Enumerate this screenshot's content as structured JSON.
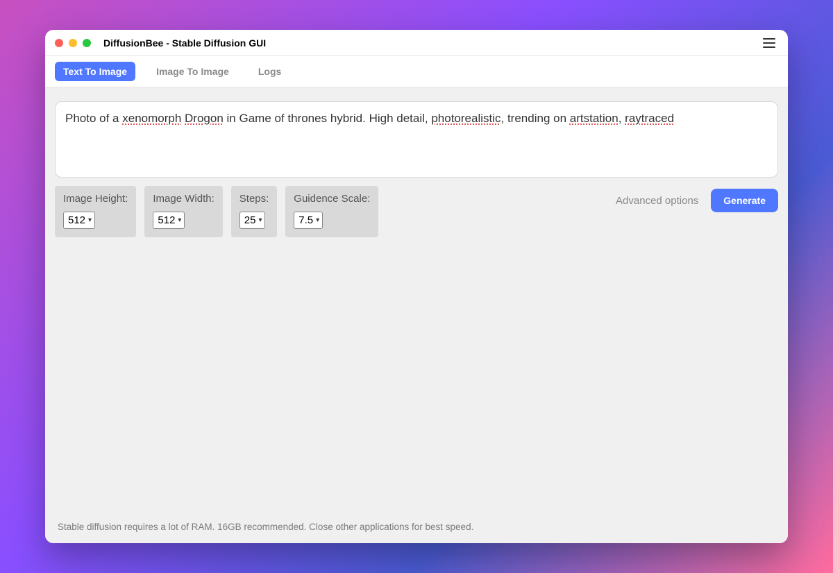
{
  "window": {
    "title": "DiffusionBee - Stable Diffusion GUI"
  },
  "tabs": {
    "text_to_image": "Text To Image",
    "image_to_image": "Image To Image",
    "logs": "Logs",
    "active": "text_to_image"
  },
  "prompt": {
    "plain": "Photo of a xenomorph Drogon in Game of thrones hybrid. High detail, photorealistic, trending on artstation, raytraced",
    "segments": [
      {
        "t": "Photo of a ",
        "spell": false
      },
      {
        "t": "xenomorph",
        "spell": true
      },
      {
        "t": " ",
        "spell": false
      },
      {
        "t": "Drogon",
        "spell": true
      },
      {
        "t": " in Game of thrones hybrid. High detail, ",
        "spell": false
      },
      {
        "t": "photorealistic",
        "spell": true
      },
      {
        "t": ", trending on ",
        "spell": false
      },
      {
        "t": "artstation",
        "spell": true
      },
      {
        "t": ", ",
        "spell": false
      },
      {
        "t": "raytraced",
        "spell": true
      }
    ]
  },
  "params": {
    "image_height": {
      "label": "Image Height:",
      "value": "512"
    },
    "image_width": {
      "label": "Image Width:",
      "value": "512"
    },
    "steps": {
      "label": "Steps:",
      "value": "25"
    },
    "guidance": {
      "label": "Guidence Scale:",
      "value": "7.5"
    }
  },
  "actions": {
    "advanced": "Advanced options",
    "generate": "Generate"
  },
  "footer": "Stable diffusion requires a lot of RAM. 16GB recommended. Close other applications for best speed."
}
